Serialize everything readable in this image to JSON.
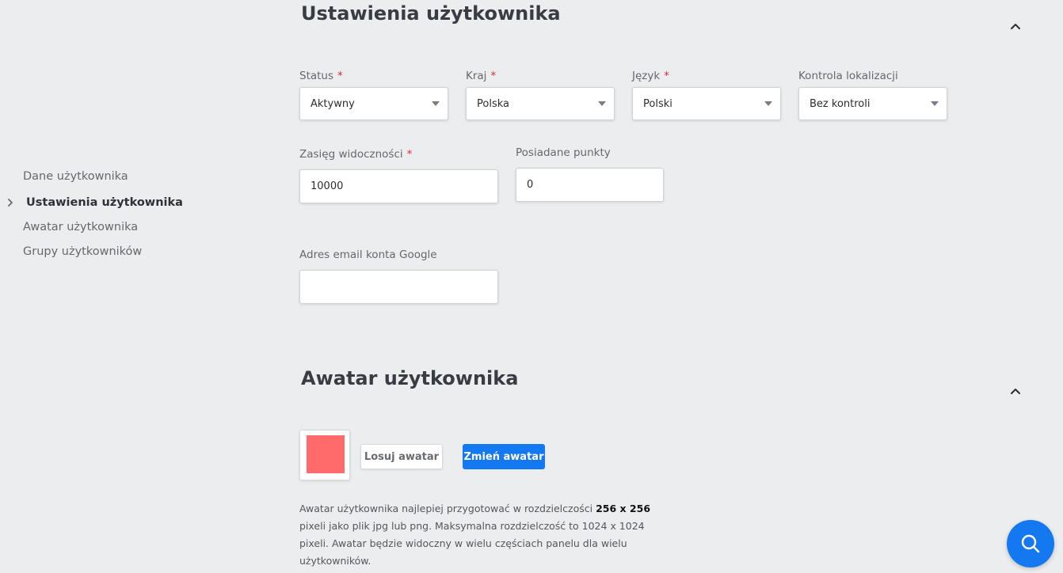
{
  "sidebar": {
    "items": [
      {
        "label": "Dane użytkownika",
        "active": false
      },
      {
        "label": "Ustawienia użytkownika",
        "active": true
      },
      {
        "label": "Awatar użytkownika",
        "active": false
      },
      {
        "label": "Grupy użytkowników",
        "active": false
      }
    ]
  },
  "settings": {
    "title": "Ustawienia użytkownika",
    "required_mark": "*",
    "status": {
      "label": "Status",
      "value": "Aktywny"
    },
    "country": {
      "label": "Kraj",
      "value": "Polska"
    },
    "language": {
      "label": "Język",
      "value": "Polski"
    },
    "location_control": {
      "label": "Kontrola lokalizacji",
      "value": "Bez kontroli"
    },
    "visibility_range": {
      "label": "Zasięg widoczności",
      "value": "10000"
    },
    "points": {
      "label": "Posiadane punkty",
      "value": "0"
    },
    "google_email": {
      "label": "Adres email konta Google",
      "value": ""
    }
  },
  "avatar": {
    "title": "Awatar użytkownika",
    "color": "#ff6b6b",
    "random_button": "Losuj awatar",
    "change_button": "Zmień awatar",
    "hint_before": "Awatar użytkownika najlepiej przygotować w rozdzielczości ",
    "hint_bold": "256 x 256",
    "hint_after": " pixeli jako plik jpg lub png. Maksymalna rozdzielczość to 1024 x 1024 pixeli. Awatar będzie widoczny w wielu częściach panelu dla wielu użytkowników."
  },
  "colors": {
    "accent": "#1478f0",
    "required": "#e0263a",
    "background": "#ecedef"
  },
  "icons": {
    "collapse": "chevron-up-icon",
    "nav_active": "chevron-right-icon",
    "dropdown": "caret-down-icon",
    "fab": "search-icon"
  }
}
